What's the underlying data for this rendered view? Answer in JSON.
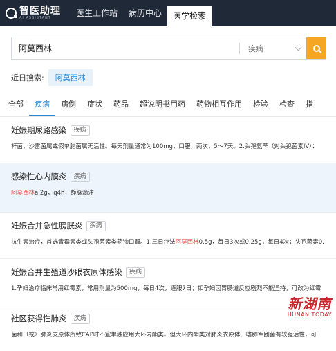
{
  "logo": {
    "text": "智医助理",
    "sub": "AI ASSISTANT"
  },
  "nav": {
    "tabs": [
      "医生工作站",
      "病历中心",
      "医学检索"
    ],
    "active": 2
  },
  "search": {
    "value": "阿莫西林",
    "type": "疾病",
    "button": "search-icon"
  },
  "recent": {
    "label": "近日搜索:",
    "item": "阿莫西林"
  },
  "categories": {
    "items": [
      "全部",
      "疾病",
      "病例",
      "症状",
      "药品",
      "超说明书用药",
      "药物相互作用",
      "检验",
      "检查",
      "指"
    ],
    "active": 1
  },
  "results": [
    {
      "title": "妊娠期尿路感染",
      "badge": "疾病",
      "desc": "杆菌、沙雷菌属或假单胞菌属无活性。每天剂量通常为100mg，口服，两次，5～7天。2.头孢氨苄（对头孢菌素IV）："
    },
    {
      "title": "感染性心内膜炎",
      "badge": "疾病",
      "desc_kw": "阿莫西林",
      "desc_rest": "a 2g，q4h，静脉滴注"
    },
    {
      "title": "妊娠合并急性膀胱炎",
      "badge": "疾病",
      "desc_pre": "抗生素治疗，首选青霉素类或头孢菌素类药物口服。1.三日疗法",
      "desc_kw": "阿莫西林",
      "desc_post": "0.5g，每日3次或0.25g，每日4次；头孢菌素0."
    },
    {
      "title": "妊娠合并生殖道沙眼衣原体感染",
      "badge": "疾病",
      "desc": "1.孕妇治疗临床常用红霉素，常用剂量为500mg，每日4次，连服7日；如孕妇因胃肠道反应剧烈不能坚持，可改为红霉"
    },
    {
      "title": "社区获得性肺炎",
      "badge": "疾病",
      "desc": "菌和（或）肺炎支原体所致CAP时不宜单独应用大环内酯类。但大环内酯类对肺炎衣原体、嗜肺军团菌有较强活性，可"
    }
  ],
  "watermark": {
    "cn": "新湖南",
    "en": "HUNAN TODAY"
  }
}
